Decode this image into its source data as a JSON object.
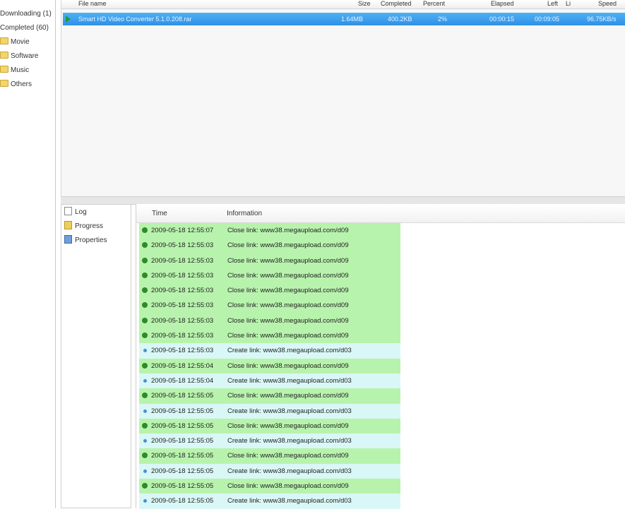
{
  "categories": [
    {
      "name": "Downloading",
      "count": "(1)"
    },
    {
      "name": "Completed",
      "count": "(60)"
    },
    {
      "name": "Movie"
    },
    {
      "name": "Software"
    },
    {
      "name": "Music"
    },
    {
      "name": "Others"
    }
  ],
  "download_list": {
    "columns": [
      "File name",
      "Size",
      "Completed",
      "Percent",
      "Elapsed",
      "Left",
      "Li",
      "Speed"
    ],
    "row": {
      "file_name": "Smart HD Video Converter 5.1.0.208.rar",
      "size": "1.64MB",
      "completed": "400.2KB",
      "percent": "2%",
      "elapsed": "00:00:15",
      "left": "00:09:05",
      "speed": "96.75KB/s"
    }
  },
  "detail_tabs": [
    "Log",
    "Progress",
    "Properties"
  ],
  "log": {
    "columns": [
      "Time",
      "Information"
    ],
    "rows": [
      {
        "type": "ok",
        "time": "2009-05-18 12:55:07",
        "info": "Close link: www38.megaupload.com/d09"
      },
      {
        "type": "ok",
        "time": "2009-05-18 12:55:03",
        "info": "Close link: www38.megaupload.com/d09"
      },
      {
        "type": "ok",
        "time": "2009-05-18 12:55:03",
        "info": "Close link: www38.megaupload.com/d09"
      },
      {
        "type": "ok",
        "time": "2009-05-18 12:55:03",
        "info": "Close link: www38.megaupload.com/d09"
      },
      {
        "type": "ok",
        "time": "2009-05-18 12:55:03",
        "info": "Close link: www38.megaupload.com/d09"
      },
      {
        "type": "ok",
        "time": "2009-05-18 12:55:03",
        "info": "Close link: www38.megaupload.com/d09"
      },
      {
        "type": "ok",
        "time": "2009-05-18 12:55:03",
        "info": "Close link: www38.megaupload.com/d09"
      },
      {
        "type": "ok",
        "time": "2009-05-18 12:55:03",
        "info": "Close link: www38.megaupload.com/d09"
      },
      {
        "type": "info",
        "time": "2009-05-18 12:55:03",
        "info": "Create link: www38.megaupload.com/d03"
      },
      {
        "type": "ok",
        "time": "2009-05-18 12:55:04",
        "info": "Close link: www38.megaupload.com/d09"
      },
      {
        "type": "info",
        "time": "2009-05-18 12:55:04",
        "info": "Create link: www38.megaupload.com/d03"
      },
      {
        "type": "ok",
        "time": "2009-05-18 12:55:05",
        "info": "Close link: www38.megaupload.com/d09"
      },
      {
        "type": "info",
        "time": "2009-05-18 12:55:05",
        "info": "Create link: www38.megaupload.com/d03"
      },
      {
        "type": "ok",
        "time": "2009-05-18 12:55:05",
        "info": "Close link: www38.megaupload.com/d09"
      },
      {
        "type": "info",
        "time": "2009-05-18 12:55:05",
        "info": "Create link: www38.megaupload.com/d03"
      },
      {
        "type": "ok",
        "time": "2009-05-18 12:55:05",
        "info": "Close link: www38.megaupload.com/d09"
      },
      {
        "type": "info",
        "time": "2009-05-18 12:55:05",
        "info": "Create link: www38.megaupload.com/d03"
      },
      {
        "type": "ok",
        "time": "2009-05-18 12:55:05",
        "info": "Close link: www38.megaupload.com/d09"
      },
      {
        "type": "info",
        "time": "2009-05-18 12:55:05",
        "info": "Create link: www38.megaupload.com/d03"
      }
    ]
  },
  "colors": {
    "selection": "#2f8fe6",
    "log_ok": "#b8f3ad",
    "log_info": "#d9f7f6"
  },
  "icons": {
    "category": "folder-icon",
    "download_status": "play-icon",
    "log_ok": "ok-circle-icon",
    "log_info": "info-icon"
  }
}
